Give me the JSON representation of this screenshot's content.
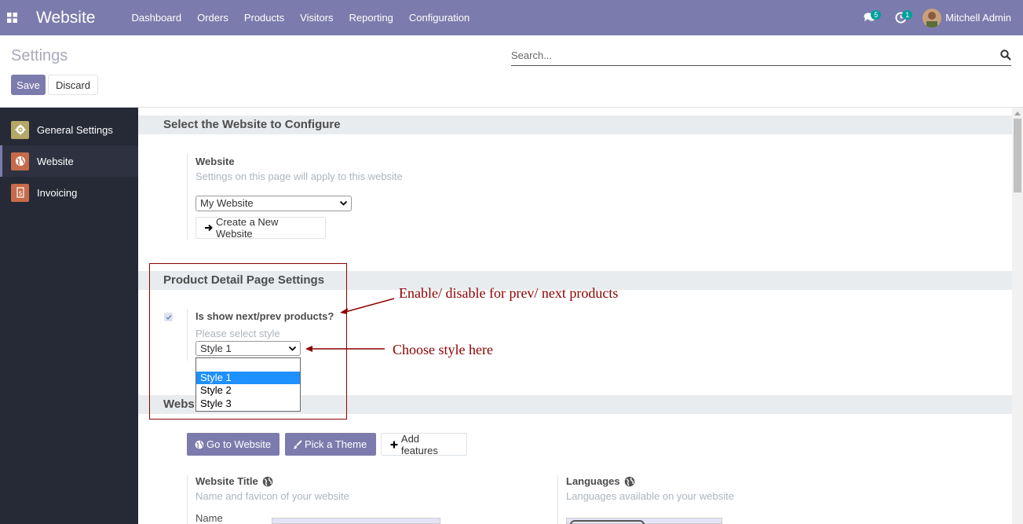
{
  "navbar": {
    "brand": "Website",
    "menu": [
      "Dashboard",
      "Orders",
      "Products",
      "Visitors",
      "Reporting",
      "Configuration"
    ],
    "chat_count": "5",
    "activity_count": "1",
    "user_name": "Mitchell Admin",
    "color": "#7c7bad"
  },
  "control": {
    "title": "Settings",
    "save_label": "Save",
    "discard_label": "Discard",
    "search_placeholder": "Search..."
  },
  "sidebar": {
    "items": [
      {
        "label": "General Settings",
        "icon": "gear-icon",
        "color": "#b3a866"
      },
      {
        "label": "Website",
        "icon": "globe-icon",
        "color": "#c56a4a",
        "active": true
      },
      {
        "label": "Invoicing",
        "icon": "invoice-icon",
        "color": "#c66b4b"
      }
    ]
  },
  "sections": {
    "select_website": {
      "title": "Select the Website to Configure",
      "label": "Website",
      "help": "Settings on this page will apply to this website",
      "selected": "My Website",
      "create_button": "Create a New Website"
    },
    "product_detail": {
      "title": "Product Detail Page Settings",
      "label": "Is show next/prev products?",
      "checked": true,
      "help": "Please select style",
      "selected": "Style 1",
      "options": [
        "",
        "Style 1",
        "Style 2",
        "Style 3"
      ]
    },
    "website": {
      "title": "Webs",
      "go_button": "Go to Website",
      "theme_button": "Pick a Theme",
      "features_button": "Add features",
      "title_label": "Website Title",
      "title_help": "Name and favicon of your website",
      "languages_label": "Languages",
      "languages_help": "Languages available on your website",
      "name_label": "Name"
    }
  },
  "annotations": {
    "enable": "Enable/ disable for prev/ next products",
    "choose": "Choose style here",
    "color": "#8b0000"
  }
}
